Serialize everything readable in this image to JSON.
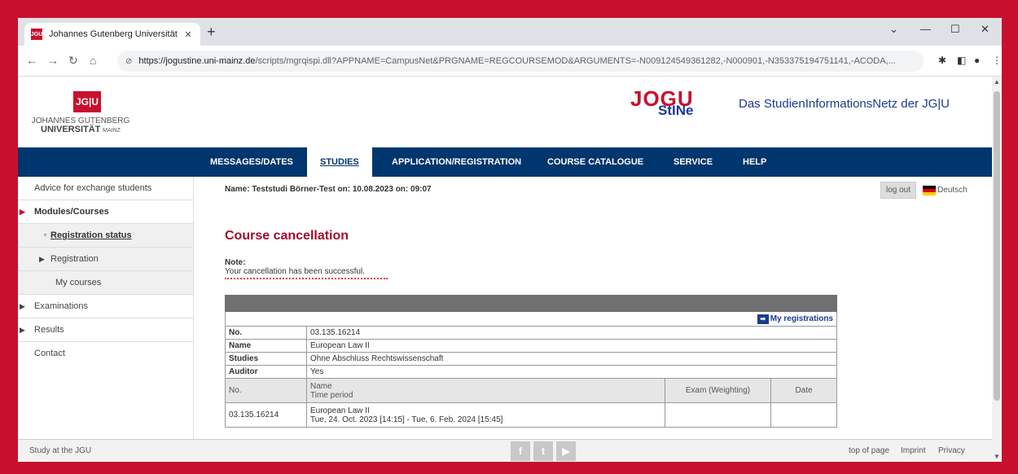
{
  "browser": {
    "tab_title": "Johannes Gutenberg Universität",
    "tab_favicon": "JGU",
    "url_host": "https://jogustine.uni-mainz.de",
    "url_path": "/scripts/mgrqispi.dll?APPNAME=CampusNet&PRGNAME=REGCOURSEMOD&ARGUMENTS=-N009124549361282,-N000901,-N353375194751141,-ACODA,..."
  },
  "header": {
    "jgu_mark": "JG|U",
    "jgu_name_line1": "JOHANNES GUTENBERG",
    "jgu_name_line2": "UNIVERSITÄT",
    "jgu_name_city": "MAINZ",
    "stine_word": "JOGU",
    "stine_sub": "StINe",
    "tagline": "Das StudienInformationsNetz der JG|U"
  },
  "nav": {
    "items": [
      {
        "label": "MESSAGES/DATES"
      },
      {
        "label": "STUDIES"
      },
      {
        "label": "APPLICATION/REGISTRATION"
      },
      {
        "label": "COURSE CATALOGUE"
      },
      {
        "label": "SERVICE"
      },
      {
        "label": "HELP"
      }
    ],
    "active": "STUDIES"
  },
  "sidebar": {
    "items": [
      {
        "label": "Advice for exchange students"
      },
      {
        "label": "Modules/Courses"
      },
      {
        "label": "Registration status"
      },
      {
        "label": "Registration"
      },
      {
        "label": "My courses"
      },
      {
        "label": "Examinations"
      },
      {
        "label": "Results"
      },
      {
        "label": "Contact"
      }
    ]
  },
  "content": {
    "name_line": "Name: Teststudi Börner-Test on: 10.08.2023 on: 09:07",
    "logout_label": "log out",
    "language_label": "Deutsch",
    "title": "Course cancellation",
    "note_label": "Note:",
    "note_text": "Your cancellation has been successful.",
    "my_registrations_label": "My registrations",
    "details": {
      "no_label": "No.",
      "no_value": "03.135.16214",
      "name_label": "Name",
      "name_value": "European Law II",
      "studies_label": "Studies",
      "studies_value": "Ohne Abschluss Rechtswissenschaft",
      "auditor_label": "Auditor",
      "auditor_value": "Yes"
    },
    "table_headers": {
      "no": "No.",
      "name": "Name",
      "time_period": "Time period",
      "exam": "Exam (Weighting)",
      "date": "Date"
    },
    "rows": [
      {
        "no": "03.135.16214",
        "name": "European Law II",
        "period": "Tue, 24. Oct. 2023 [14:15] - Tue, 6. Feb. 2024 [15:45]"
      }
    ]
  },
  "footer": {
    "left": "Study at the JGU",
    "top_of_page": "top of page",
    "imprint": "Imprint",
    "privacy": "Privacy",
    "social": [
      "f",
      "t",
      "▶"
    ]
  }
}
